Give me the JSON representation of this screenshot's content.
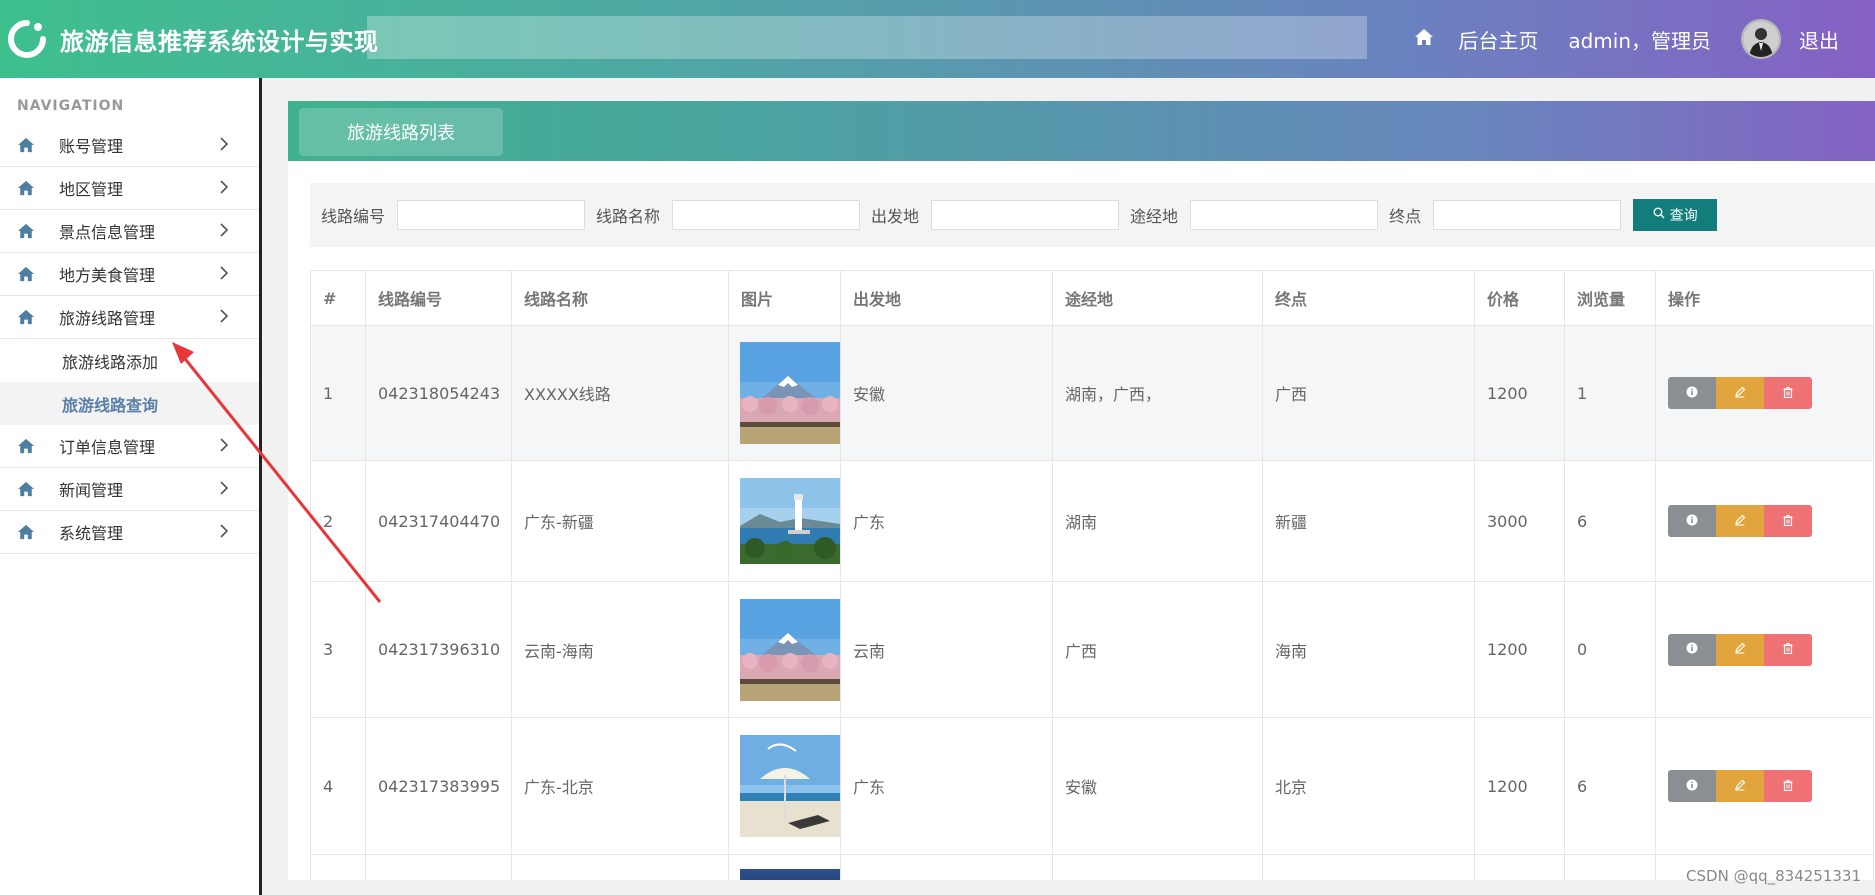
{
  "header": {
    "title": "旅游信息推荐系统设计与实现",
    "home_label": "后台主页",
    "user_label": "admin，管理员",
    "logout_label": "退出"
  },
  "sidebar": {
    "heading": "NAVIGATION",
    "items": [
      {
        "label": "账号管理"
      },
      {
        "label": "地区管理"
      },
      {
        "label": "景点信息管理"
      },
      {
        "label": "地方美食管理"
      },
      {
        "label": "旅游线路管理"
      },
      {
        "label": "订单信息管理"
      },
      {
        "label": "新闻管理"
      },
      {
        "label": "系统管理"
      }
    ],
    "subitems": [
      {
        "label": "旅游线路添加"
      },
      {
        "label": "旅游线路查询"
      }
    ]
  },
  "main": {
    "tab_label": "旅游线路列表",
    "search": {
      "fields": [
        {
          "label": "线路编号",
          "value": ""
        },
        {
          "label": "线路名称",
          "value": ""
        },
        {
          "label": "出发地",
          "value": ""
        },
        {
          "label": "途经地",
          "value": ""
        },
        {
          "label": "终点",
          "value": ""
        }
      ],
      "query_label": "查询"
    },
    "table": {
      "headers": [
        "#",
        "线路编号",
        "线路名称",
        "图片",
        "出发地",
        "途经地",
        "终点",
        "价格",
        "浏览量",
        "操作"
      ],
      "rows": [
        {
          "idx": "1",
          "code": "042318054243",
          "name": "XXXXX线路",
          "image": "mount-fuji-cherry",
          "from": "安徽",
          "via": "湖南，广西，",
          "to": "广西",
          "price": "1200",
          "views": "1"
        },
        {
          "idx": "2",
          "code": "042317404470",
          "name": "广东-新疆",
          "image": "lighthouse-coast",
          "from": "广东",
          "via": "湖南",
          "to": "新疆",
          "price": "3000",
          "views": "6"
        },
        {
          "idx": "3",
          "code": "042317396310",
          "name": "云南-海南",
          "image": "mount-fuji-cherry",
          "from": "云南",
          "via": "广西",
          "to": "海南",
          "price": "1200",
          "views": "0"
        },
        {
          "idx": "4",
          "code": "042317383995",
          "name": "广东-北京",
          "image": "beach-umbrella",
          "from": "广东",
          "via": "安徽",
          "to": "北京",
          "price": "1200",
          "views": "6"
        }
      ]
    }
  },
  "watermark": "CSDN @qq_834251331",
  "colors": {
    "accent_teal": "#127d7a",
    "header_start": "#3ec08e",
    "header_end": "#8660c4",
    "btn_info": "#8a8f94",
    "btn_edit": "#e2a43c",
    "btn_delete": "#f07173",
    "annotation_arrow": "#e8363a"
  }
}
